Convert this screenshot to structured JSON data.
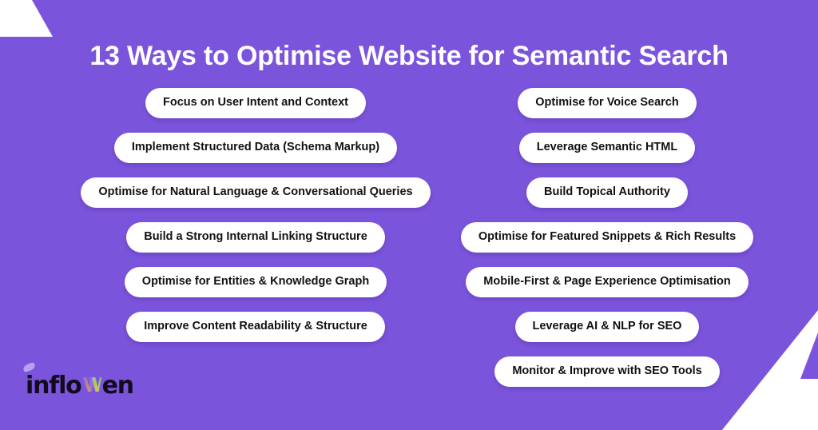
{
  "page": {
    "background_color": "#7b54dc",
    "pill_background": "#ffffff",
    "pill_text_color": "#111111",
    "title_color": "#ffffff"
  },
  "header": {
    "title": "13 Ways to Optimise Website for Semantic Search"
  },
  "columns": {
    "left": {
      "items": [
        {
          "label": "Focus on User Intent and Context"
        },
        {
          "label": "Implement Structured Data (Schema Markup)"
        },
        {
          "label": "Optimise for Natural Language & Conversational Queries"
        },
        {
          "label": "Build a Strong Internal Linking Structure"
        },
        {
          "label": "Optimise for Entities & Knowledge Graph"
        },
        {
          "label": "Improve Content Readability & Structure"
        }
      ]
    },
    "right": {
      "items": [
        {
          "label": "Optimise for Voice Search"
        },
        {
          "label": "Leverage Semantic HTML"
        },
        {
          "label": "Build Topical Authority"
        },
        {
          "label": "Optimise for Featured Snippets & Rich Results"
        },
        {
          "label": "Mobile-First & Page Experience Optimisation"
        },
        {
          "label": "Leverage AI & NLP for SEO"
        },
        {
          "label": "Monitor & Improve with SEO Tools"
        }
      ]
    }
  },
  "logo": {
    "text_before": "inflo",
    "text_after": "en",
    "mark": "colorful-w-icon",
    "swoosh": "lavender-swoosh-icon",
    "colors": [
      "#f59b2c",
      "#f2c744",
      "#6fc77a",
      "#8b6ee8",
      "#b9a0ee"
    ]
  },
  "decorations": {
    "top_left": "white-corner-triangle",
    "bottom_right": "white-corner-triangle"
  }
}
